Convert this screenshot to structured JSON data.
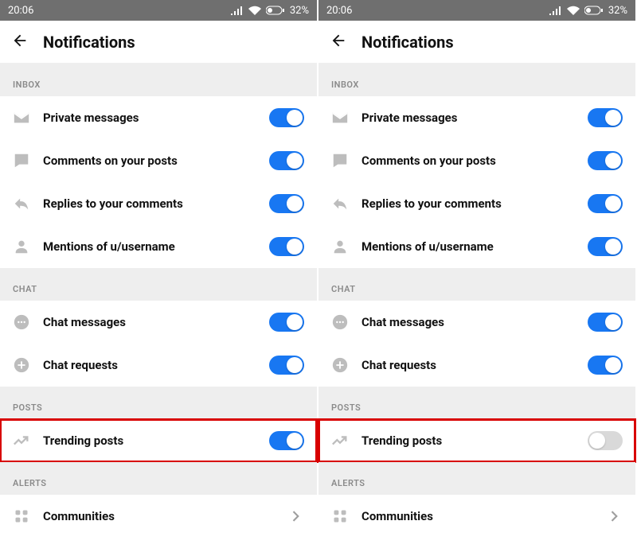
{
  "status": {
    "time": "20:06",
    "battery": "32%"
  },
  "appbar": {
    "title": "Notifications"
  },
  "sections": {
    "inbox": "INBOX",
    "chat": "CHAT",
    "posts": "POSTS",
    "alerts": "ALERTS"
  },
  "rows": {
    "private_messages": "Private messages",
    "comments_on_posts": "Comments on your posts",
    "replies_to_comments": "Replies to your comments",
    "mentions": "Mentions of u/username",
    "chat_messages": "Chat messages",
    "chat_requests": "Chat requests",
    "trending_posts": "Trending posts",
    "communities": "Communities"
  },
  "panels": {
    "left": {
      "trending_on": true
    },
    "right": {
      "trending_on": false
    }
  }
}
